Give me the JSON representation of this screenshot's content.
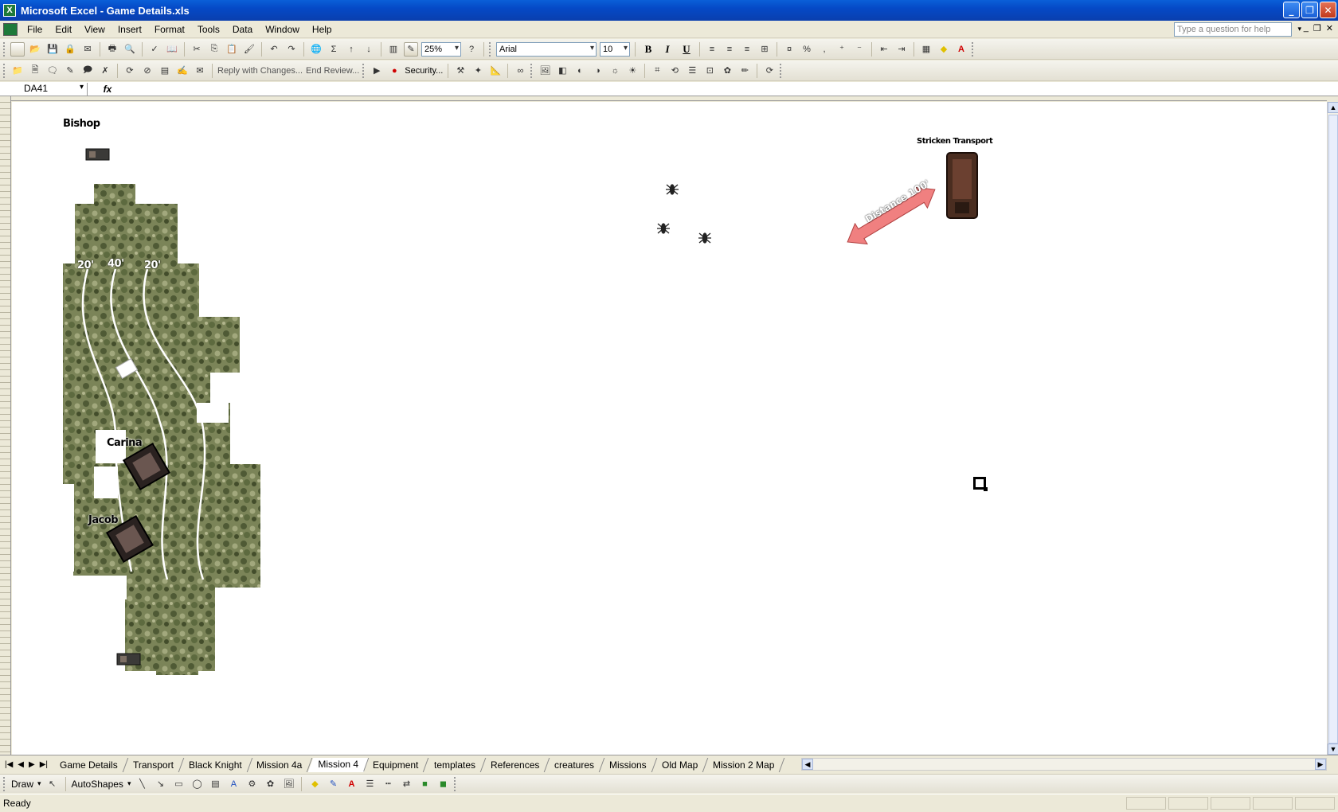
{
  "window": {
    "title": "Microsoft Excel - Game Details.xls"
  },
  "menu": [
    "File",
    "Edit",
    "View",
    "Insert",
    "Format",
    "Tools",
    "Data",
    "Window",
    "Help"
  ],
  "help_placeholder": "Type a question for help",
  "toolbar": {
    "zoom": "25%",
    "font": "Arial",
    "font_size": "10",
    "bold": "B",
    "italic": "I",
    "underline": "U",
    "percent": "%",
    "comma": ",",
    "sigma": "Σ"
  },
  "reviewing": {
    "reply_label": "Reply with Changes...",
    "end_review_label": "End Review...",
    "security_label": "Security..."
  },
  "formula_bar": {
    "name_box": "DA41",
    "fx": "fx",
    "value": ""
  },
  "map": {
    "labels": {
      "bishop": "Bishop",
      "carina": "Carina",
      "jacob": "Jacob",
      "stricken_transport": "Stricken Transport",
      "distance": "Distance 100'",
      "lane1": "20'",
      "lane2": "40'",
      "lane3": "20'"
    }
  },
  "sheet_tabs": [
    "Game Details",
    "Transport",
    "Black Knight",
    "Mission 4a",
    "Mission 4",
    "Equipment",
    "templates",
    "References",
    "creatures",
    "Missions",
    "Old Map",
    "Mission 2 Map"
  ],
  "active_tab": "Mission 4",
  "draw_toolbar": {
    "draw_label": "Draw",
    "autoshapes_label": "AutoShapes"
  },
  "status": "Ready",
  "colors": {
    "title_bar": "#0a54d0",
    "terrain": "#6e7a4d",
    "arrow": "#f08080"
  }
}
